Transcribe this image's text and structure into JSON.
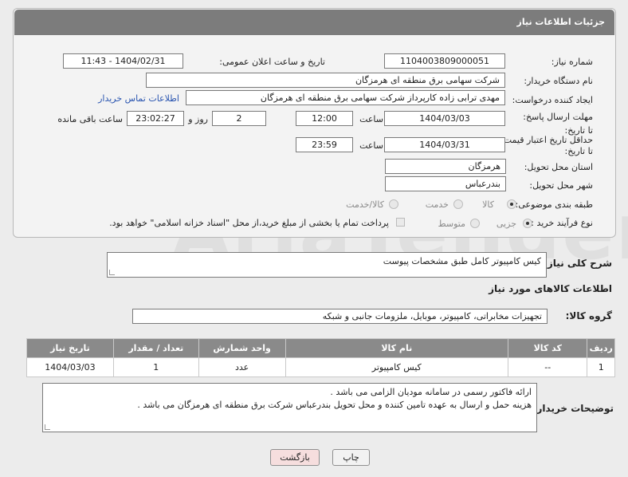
{
  "header": {
    "title": "جزئیات اطلاعات نیاز"
  },
  "form": {
    "need_number_label": "شماره نیاز:",
    "need_number": "1104003809000051",
    "announce_label": "تاریخ و ساعت اعلان عمومی:",
    "announce_value": "1404/02/31 - 11:43",
    "buyer_org_label": "نام دستگاه خریدار:",
    "buyer_org": "شرکت سهامی برق منطقه ای هرمزگان",
    "creator_label": "ایجاد کننده درخواست:",
    "creator": "مهدی ترابی زاده کارپرداز شرکت سهامی برق منطقه ای هرمزگان",
    "contact_link": "اطلاعات تماس خریدار",
    "reply_deadline_label": "مهلت ارسال پاسخ: تا تاریخ:",
    "reply_date": "1404/03/03",
    "time_label": "ساعت",
    "reply_time": "12:00",
    "days_value": "2",
    "days_label": "روز و",
    "remaining_time": "23:02:27",
    "remaining_label": "ساعت باقی مانده",
    "price_validity_label": "حداقل تاریخ اعتبار قیمت: تا تاریخ:",
    "price_date": "1404/03/31",
    "price_time": "23:59",
    "province_label": "استان محل تحویل:",
    "province": "هرمزگان",
    "city_label": "شهر محل تحویل:",
    "city": "بندرعباس",
    "category_label": "طبقه بندی موضوعی:",
    "category_options": [
      "کالا",
      "خدمت",
      "کالا/خدمت"
    ],
    "process_label": "نوع فرآیند خرید :",
    "process_options": [
      "جزیی",
      "متوسط"
    ],
    "payment_note": "پرداخت تمام یا بخشی از مبلغ خرید،از محل \"اسناد خزانه اسلامی\" خواهد بود."
  },
  "description": {
    "label": "شرح کلی نیاز:",
    "text": "کیس کامپیوتر کامل طبق مشخصات پیوست"
  },
  "goods_info": {
    "title": "اطلاعات کالاهای مورد نیاز",
    "group_label": "گروه کالا:",
    "group_value": "تجهیزات مخابراتی، کامپیوتر، موبایل، ملزومات جانبی و شبکه"
  },
  "table": {
    "headers": [
      "ردیف",
      "کد کالا",
      "نام کالا",
      "واحد شمارش",
      "تعداد / مقدار",
      "تاریخ نیاز"
    ],
    "rows": [
      [
        "1",
        "--",
        "کیس کامپیوتر",
        "عدد",
        "1",
        "1404/03/03"
      ]
    ]
  },
  "buyer_notes": {
    "label": "توضیحات خریدار:",
    "line1": "ارائه فاکتور رسمی در سامانه مودیان الزامی می باشد .",
    "line2": "هزینه حمل و ارسال به عهده تامین کننده و محل تحویل بندرعباس شرکت برق منطقه ای هرمزگان می باشد ."
  },
  "buttons": {
    "print": "چاپ",
    "back": "بازگشت"
  },
  "watermark": "AriaTender.net",
  "colors": {
    "header_bg": "#7c7c7c",
    "table_header_bg": "#8a8a8a",
    "link": "#2a55b0",
    "back_button_bg": "#f6dede"
  }
}
